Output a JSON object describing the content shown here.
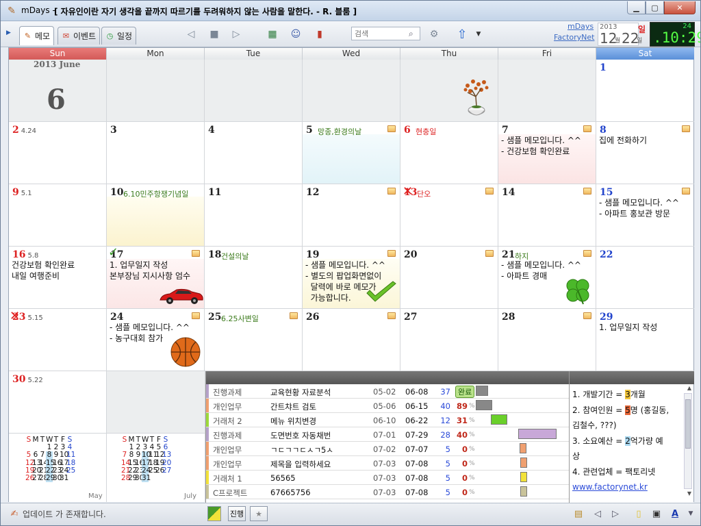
{
  "window": {
    "app_name": "mDays -",
    "quote": "[ 자유인이란 자기 생각을 끝까지 따르기를 두려워하지 않는 사람을 말한다. - R. 블룸 ]"
  },
  "tabs": [
    {
      "label": "메모"
    },
    {
      "label": "이벤트"
    },
    {
      "label": "일정"
    }
  ],
  "search": {
    "placeholder": "검색"
  },
  "links": {
    "mdays": "mDays",
    "factorynet": "FactoryNet"
  },
  "datebox": {
    "year": "2013",
    "month": "12",
    "wol": "월",
    "day": "22",
    "il": "일",
    "dow": "일"
  },
  "clock": {
    "seconds": "24",
    "time": ".10:29"
  },
  "dow": [
    "Sun",
    "Mon",
    "Tue",
    "Wed",
    "Thu",
    "Fri",
    "Sat"
  ],
  "header_cell": {
    "year_month": "2013  June",
    "month": "6"
  },
  "days": {
    "d1": "1",
    "d2": "2",
    "d2s": "4.24",
    "d3": "3",
    "d4": "4",
    "d5": "5",
    "d5h": "망종,환경의날",
    "d6": "6",
    "d6h": "현충일",
    "d7": "7",
    "d7m": "- 샘플 메모입니다. ^^\n- 건강보험 확인완료",
    "d8": "8",
    "d8m": "집에 전화하기",
    "d9": "9",
    "d9s": "5.1",
    "d10": "10",
    "d10h": "6.10민주항쟁기념일",
    "d11": "11",
    "d12": "12",
    "d13": "13",
    "d13h": "단오",
    "d14": "14",
    "d15": "15",
    "d15m": "- 샘플 메모입니다. ^^\n- 아파트 홍보관 방문",
    "d16": "16",
    "d16s": "5.8",
    "d16m": "건강보험 확인완료\n내일 여행준비",
    "d17": "17",
    "d17m": "1. 업무일지 작성\n본부장님 지시사항 엄수",
    "d18": "18",
    "d18h": "건설의날",
    "d19": "19",
    "d19m": "- 샘플 메모입니다. ^^\n- 별도의 팝업화면없이\n  달력에 바로 메모가\n  가능합니다.",
    "d20": "20",
    "d21": "21",
    "d21h": "하지",
    "d21m": "- 샘플 메모입니다. ^^\n- 아파트 경매",
    "d22": "22",
    "d23": "23",
    "d23s": "5.15",
    "d24": "24",
    "d24m": "- 샘플 메모입니다. ^^\n- 농구대회 참가",
    "d25": "25",
    "d25h": "6.25사변일",
    "d26": "26",
    "d27": "27",
    "d28": "28",
    "d29": "29",
    "d29m": "1. 업무일지 작성",
    "d30": "30",
    "d30s": "5.22"
  },
  "mini_may": {
    "label": "May",
    "rows": [
      "   1 2 3 4",
      "5 6 7 8 9 10 11",
      "12 13 14 15 16 17 18",
      "19 20 21 22 23 24 25",
      "26 27 28 29 30 31"
    ]
  },
  "mini_july": {
    "label": "July",
    "rows": [
      "  1 2 3 4 5 6",
      "7 8 9 10 11 12 13",
      "14 15 16 17 18 19 20",
      "21 22 23 24 25 26 27",
      "28 29 30 31"
    ]
  },
  "mini_header": [
    "S",
    "M",
    "T",
    "W",
    "T",
    "F",
    "S"
  ],
  "gantt": [
    {
      "type": "진행과제",
      "title": "교육현황 자료분석",
      "start": "05-02",
      "end": "06-08",
      "days": "37",
      "pct": "완료",
      "color": "#b6a2c9"
    },
    {
      "type": "개인업무",
      "title": "간트챠트 검토",
      "start": "05-06",
      "end": "06-15",
      "days": "40",
      "pct": "89",
      "color": "#f0a070"
    },
    {
      "type": "거래처 2",
      "title": "메뉴 위치변경",
      "start": "06-10",
      "end": "06-22",
      "days": "12",
      "pct": "31",
      "color": "#9ed93a"
    },
    {
      "type": "진행과제",
      "title": "도면번호 자동채번",
      "start": "07-01",
      "end": "07-29",
      "days": "28",
      "pct": "40",
      "color": "#b6a2c9"
    },
    {
      "type": "개인업무",
      "title": "ㄱㄷㄱㄱㄷㅅㄱ5ㅅ",
      "start": "07-02",
      "end": "07-07",
      "days": "5",
      "pct": "0",
      "color": "#f0a070"
    },
    {
      "type": "개인업무",
      "title": "제목을 입력하세요",
      "start": "07-03",
      "end": "07-08",
      "days": "5",
      "pct": "0",
      "color": "#f0a070"
    },
    {
      "type": "거래처 1",
      "title": "56565",
      "start": "07-03",
      "end": "07-08",
      "days": "5",
      "pct": "0",
      "color": "#f2e23a"
    },
    {
      "type": "C프로젝트",
      "title": "67665756",
      "start": "07-03",
      "end": "07-08",
      "days": "5",
      "pct": "0",
      "color": "#c9c39a"
    }
  ],
  "notes": {
    "l1a": "1. 개발기간 = ",
    "l1b": "3",
    "l1c": "개월",
    "l2a": "2. 참여인원 = ",
    "l2b": "5",
    "l2c": "명 (홍길동,",
    "l3": "김철수, ???)",
    "l4a": "3. 소요예산 = ",
    "l4b": "2",
    "l4c": "억가량 예",
    "l5": "상",
    "l6": "4. 관련업체 = 팩토리넷",
    "link": "www.factorynet.kr"
  },
  "status": {
    "text": "업데이트 가 존재합니다.",
    "progress_btn": "진행"
  }
}
